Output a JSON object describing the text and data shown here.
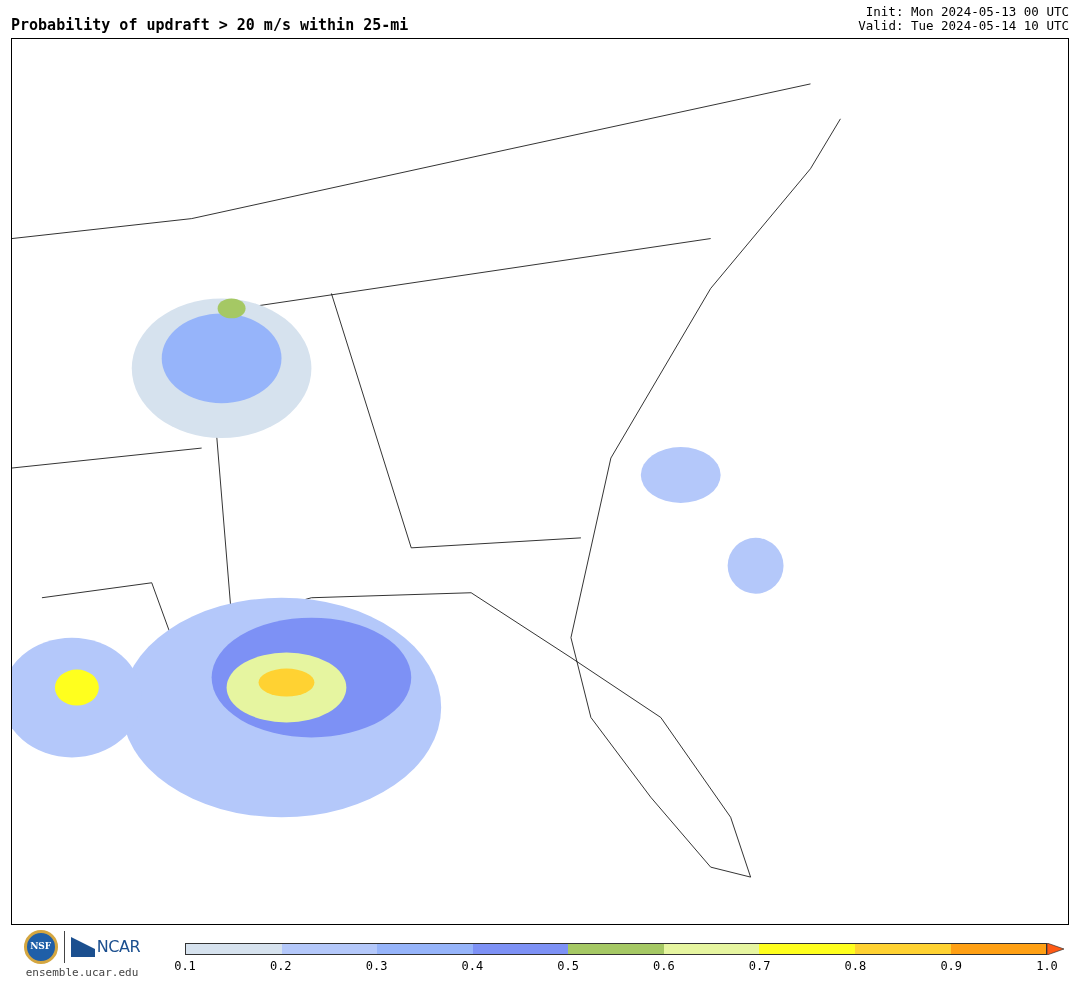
{
  "title": "Probability of updraft > 20 m/s within 25-mi",
  "run_info": [
    "Init: Mon 2024-05-13 00 UTC",
    "Valid: Tue 2024-05-14 10 UTC"
  ],
  "logos": {
    "seal_text": "NSF",
    "wordmark": "NCAR",
    "site": "ensemble.ucar.edu"
  },
  "colorbar": {
    "segments": [
      {
        "color": "#d6e2ee"
      },
      {
        "color": "#b4c8fa"
      },
      {
        "color": "#96b4fa"
      },
      {
        "color": "#7d91f5"
      },
      {
        "color": "#a5c864"
      },
      {
        "color": "#e6f5a0"
      },
      {
        "color": "#ffff1e"
      },
      {
        "color": "#ffd232"
      },
      {
        "color": "#ffa014"
      },
      {
        "color": "#ff5a14",
        "kind": "arrow"
      }
    ],
    "ticks": [
      "0.1",
      "0.2",
      "0.3",
      "0.4",
      "0.5",
      "0.6",
      "0.7",
      "0.8",
      "0.9",
      "1.0"
    ]
  }
}
